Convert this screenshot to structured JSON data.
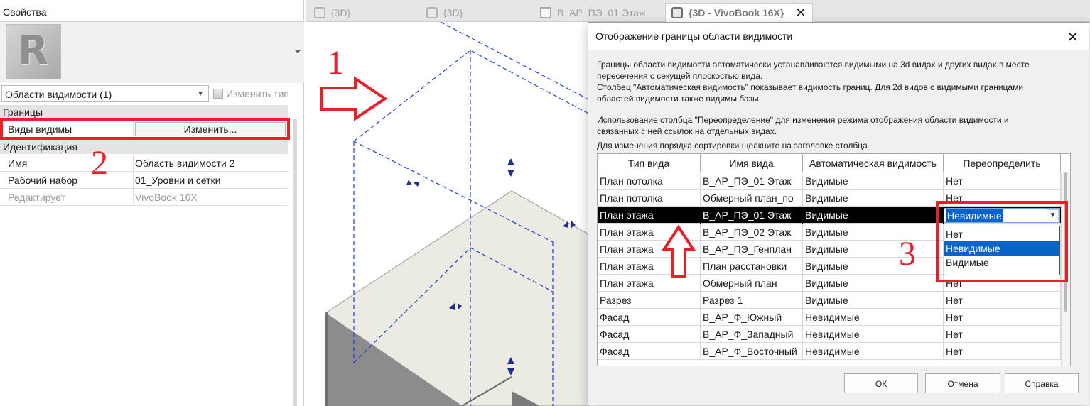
{
  "properties": {
    "title": "Свойства",
    "type_selector": "Области видимости (1)",
    "edit_type": "Изменить тип",
    "sections": [
      {
        "label": "Границы"
      },
      {
        "label": "Идентификация"
      }
    ],
    "rows": [
      {
        "key": "Виды видимы",
        "button": "Изменить..."
      },
      {
        "key": "Имя",
        "value": "Область видимости 2"
      },
      {
        "key": "Рабочий набор",
        "value": "01_Уровни и сетки"
      },
      {
        "key": "Редактирует",
        "value": "VivoBook 16X"
      }
    ]
  },
  "tabs": [
    {
      "label": "{3D}"
    },
    {
      "label": "{3D}"
    },
    {
      "label": "В_АР_ПЭ_01 Этаж"
    },
    {
      "label": "{3D - VivoBook 16X}",
      "active": true
    }
  ],
  "annotations": [
    "1",
    "2",
    "3"
  ],
  "colors": {
    "annotation_red": "#e8202a",
    "selection_blue": "#0a63c9",
    "boundary_blue": "#1a3fd6"
  },
  "dialog": {
    "title": "Отображение границы области видимости",
    "info1": "Границы области видимости автоматически устанавливаются видимыми на 3d видах и других видах в месте",
    "info2": "пересечения с секущей плоскостью вида.",
    "info3": "Столбец \"Автоматическая видимость\" показывает видимость границ. Для 2d видов с видимыми границами",
    "info4": "областей видимости также видимы базы.",
    "info5": "Использование столбца \"Переопределение\" для изменения режима отображения области видимости и",
    "info6": "связанных с ней ссылок на отдельных видах.",
    "info7": "Для изменения порядка сортировки щелкните на заголовке столбца.",
    "columns": [
      "Тип вида",
      "Имя вида",
      "Автоматическая видимость",
      "Переопределить"
    ],
    "rows": [
      [
        "План потолка",
        "В_АР_ПЭ_01 Этаж",
        "Видимые",
        "Нет"
      ],
      [
        "План потолка",
        "Обмерный план_по",
        "Видимые",
        "Нет"
      ],
      [
        "План этажа",
        "В_АР_ПЭ_01 Этаж",
        "Видимые",
        "Невидимые"
      ],
      [
        "План этажа",
        "В_АР_ПЭ_02 Этаж",
        "Видимые",
        "Нет"
      ],
      [
        "План этажа",
        "В_АР_ПЭ_Генплан",
        "Видимые",
        "Нет"
      ],
      [
        "План этажа",
        "План расстановки",
        "Видимые",
        "Нет"
      ],
      [
        "План этажа",
        "Обмерный план",
        "Видимые",
        "Нет"
      ],
      [
        "Разрез",
        "Разрез 1",
        "Видимые",
        "Нет"
      ],
      [
        "Фасад",
        "В_АР_Ф_Южный",
        "Невидимые",
        "Нет"
      ],
      [
        "Фасад",
        "В_АР_Ф_Западный",
        "Невидимые",
        "Нет"
      ],
      [
        "Фасад",
        "В_АР_Ф_Восточный",
        "Невидимые",
        "Нет"
      ]
    ],
    "selected_row": 2,
    "dropdown_options": [
      "Нет",
      "Невидимые",
      "Видимые"
    ],
    "dropdown_highlighted": "Невидимые",
    "buttons": {
      "ok": "ОК",
      "cancel": "Отмена",
      "help": "Справка"
    }
  }
}
